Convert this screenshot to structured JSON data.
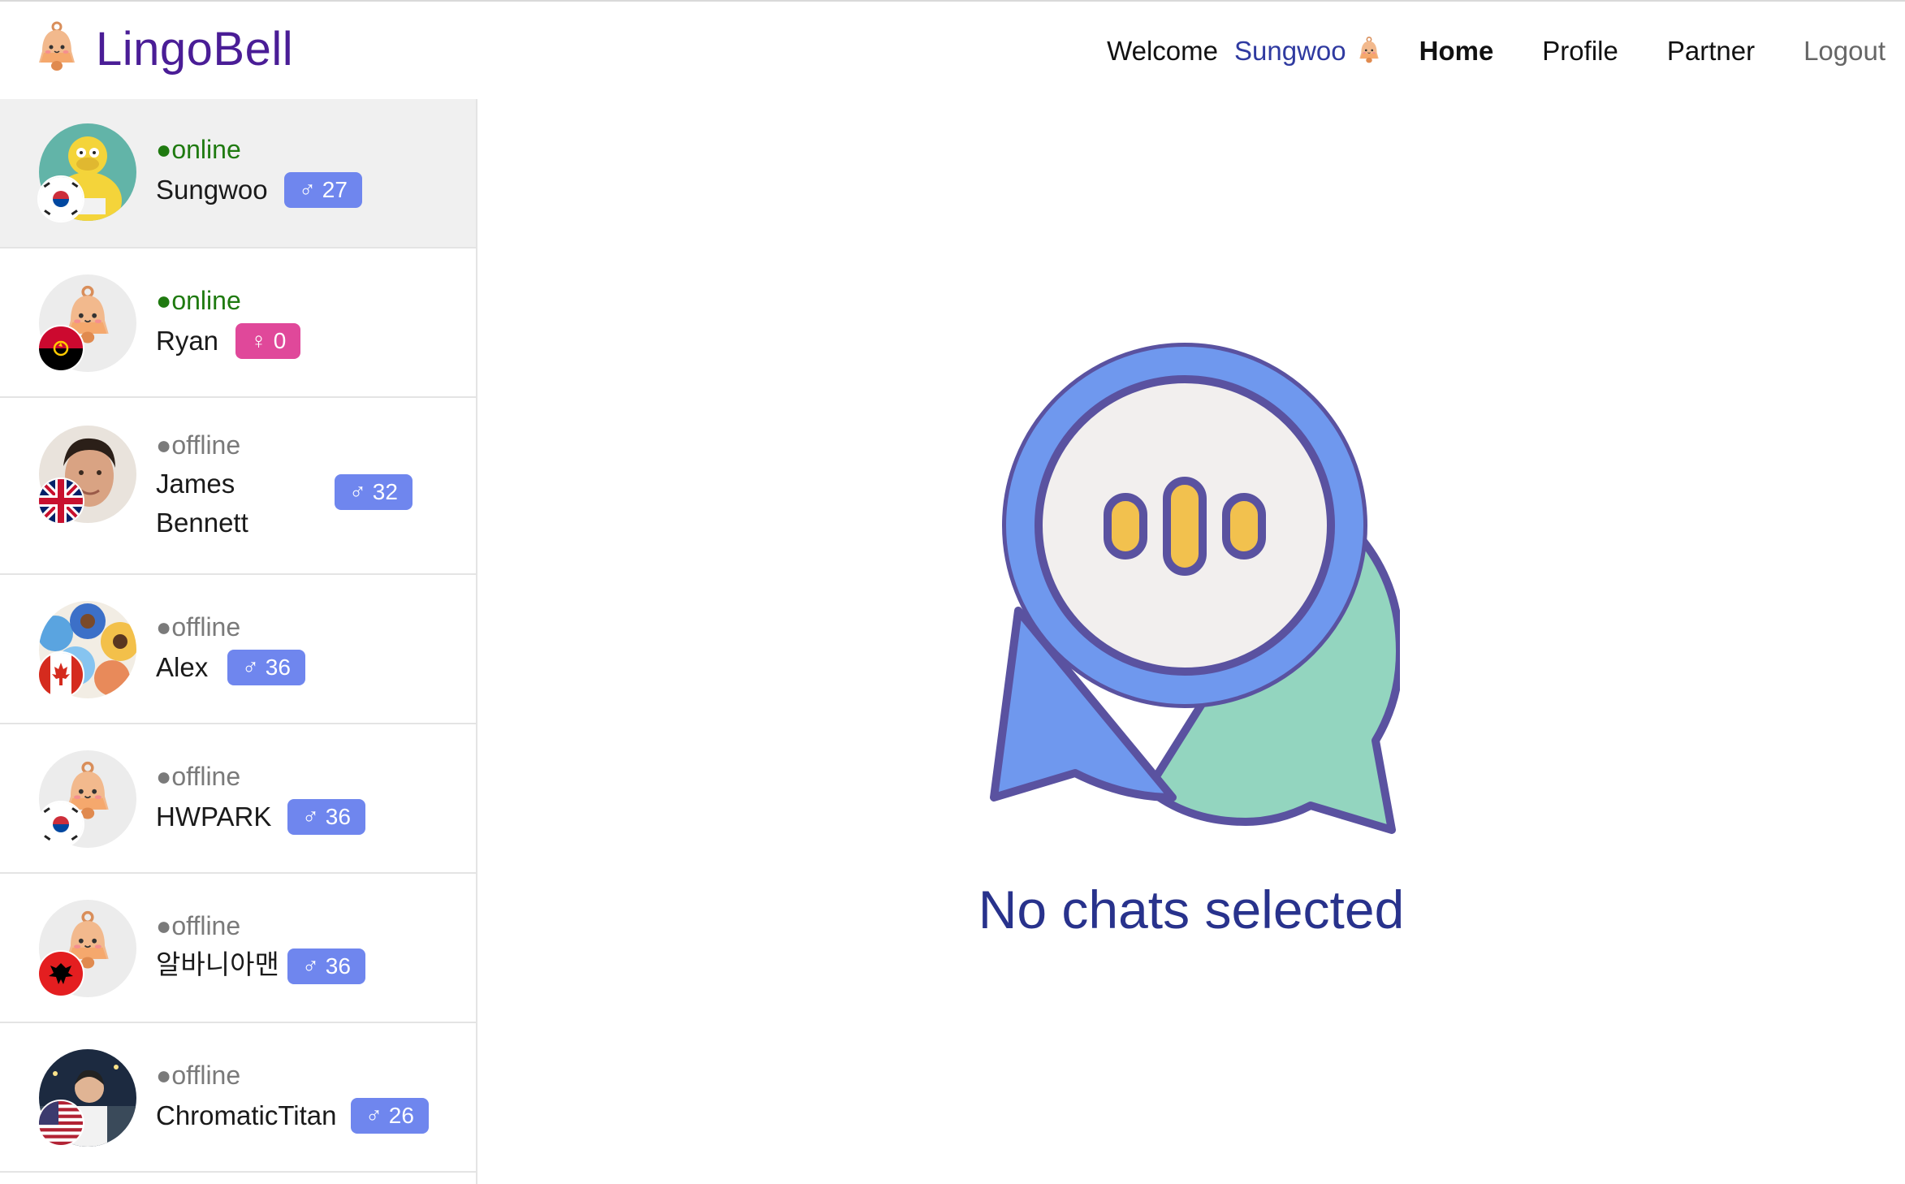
{
  "app": {
    "name": "LingoBell"
  },
  "nav": {
    "welcome_label": "Welcome",
    "user_name": "Sungwoo",
    "links": [
      "Home",
      "Profile",
      "Partner",
      "Logout"
    ],
    "active": "Home"
  },
  "contacts": [
    {
      "name": "Sungwoo",
      "status": "●online",
      "gender_badge": "♂ 27",
      "gender": "male",
      "flag_icon": "south-korea-flag-icon",
      "avatar_icon": "cartoon-character-avatar"
    },
    {
      "name": "Ryan",
      "status": "●online",
      "gender_badge": "♀ 0",
      "gender": "female",
      "flag_icon": "angola-flag-icon",
      "avatar_icon": "bell-mascot-avatar"
    },
    {
      "name_line1": "James",
      "name_line2": "Bennett",
      "status": "●offline",
      "gender_badge": "♂ 32",
      "gender": "male",
      "flag_icon": "united-kingdom-flag-icon",
      "avatar_icon": "photo-avatar"
    },
    {
      "name": "Alex",
      "status": "●offline",
      "gender_badge": "♂ 36",
      "gender": "male",
      "flag_icon": "canada-flag-icon",
      "avatar_icon": "group-illustration-avatar"
    },
    {
      "name": "HWPARK",
      "status": "●offline",
      "gender_badge": "♂ 36",
      "gender": "male",
      "flag_icon": "south-korea-flag-icon",
      "avatar_icon": "bell-mascot-avatar"
    },
    {
      "name": "알바니아맨",
      "status": "●offline",
      "gender_badge": "♂ 36",
      "gender": "male",
      "flag_icon": "albania-flag-icon",
      "avatar_icon": "bell-mascot-avatar"
    },
    {
      "name": "ChromaticTitan",
      "status": "●offline",
      "gender_badge": "♂ 26",
      "gender": "male",
      "flag_icon": "united-states-flag-icon",
      "avatar_icon": "photo-avatar"
    }
  ],
  "main": {
    "empty_message": "No chats selected",
    "empty_icon": "chat-bubbles-icon"
  },
  "colors": {
    "brand": "#4a1d96",
    "online": "#1f7a10",
    "offline": "#7a7a7a",
    "male_badge": "#6f86ee",
    "female_badge": "#e0489a",
    "empty_text": "#28328c"
  }
}
